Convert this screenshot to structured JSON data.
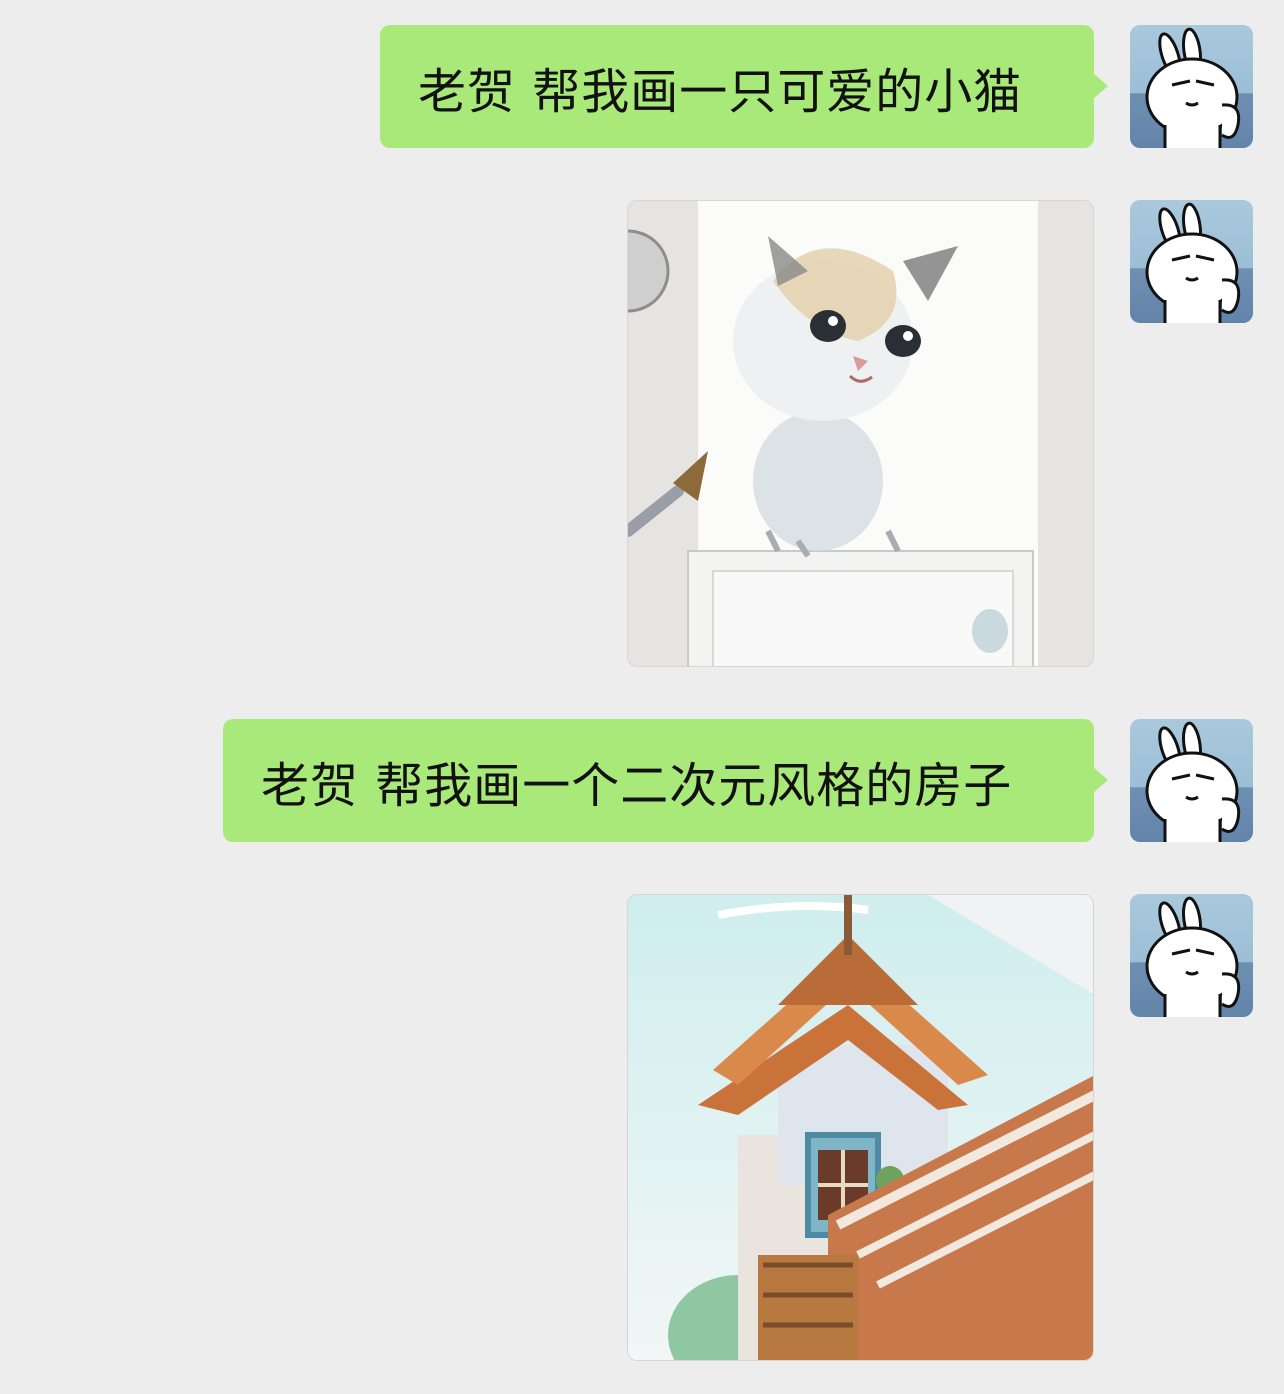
{
  "chat": {
    "messages": [
      {
        "type": "text",
        "text": "老贺 帮我画一只可爱的小猫"
      },
      {
        "type": "image",
        "subject": "cat"
      },
      {
        "type": "text",
        "text": "老贺 帮我画一个二次元风格的房子"
      },
      {
        "type": "image",
        "subject": "house"
      }
    ]
  },
  "colors": {
    "background": "#ededed",
    "bubble": "#a9e97a"
  },
  "icons": {
    "avatar": "rabbit-avatar-icon",
    "paintbrush": "paintbrush-icon"
  }
}
